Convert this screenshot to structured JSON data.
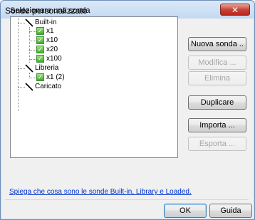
{
  "window": {
    "title": "Sonde personalizzate",
    "close_label": "✕"
  },
  "group": {
    "label": "Selezionare una sonda"
  },
  "tree": {
    "nodes": [
      {
        "label": "Built-in"
      },
      {
        "label": "x1"
      },
      {
        "label": "x10"
      },
      {
        "label": "x20"
      },
      {
        "label": "x100"
      },
      {
        "label": "Libreria"
      },
      {
        "label": "x1 (2)"
      },
      {
        "label": "Caricato"
      }
    ]
  },
  "buttons": {
    "new_probe": "Nuova sonda ..",
    "edit": "Modifica ...",
    "delete": "Elimina",
    "duplicate": "Duplicare",
    "import": "Importa ...",
    "export": "Esporta ..."
  },
  "help_link": "Spiega che cosa sono le sonde Built-in, Library e Loaded.",
  "footer": {
    "ok": "OK",
    "help": "Guida"
  }
}
